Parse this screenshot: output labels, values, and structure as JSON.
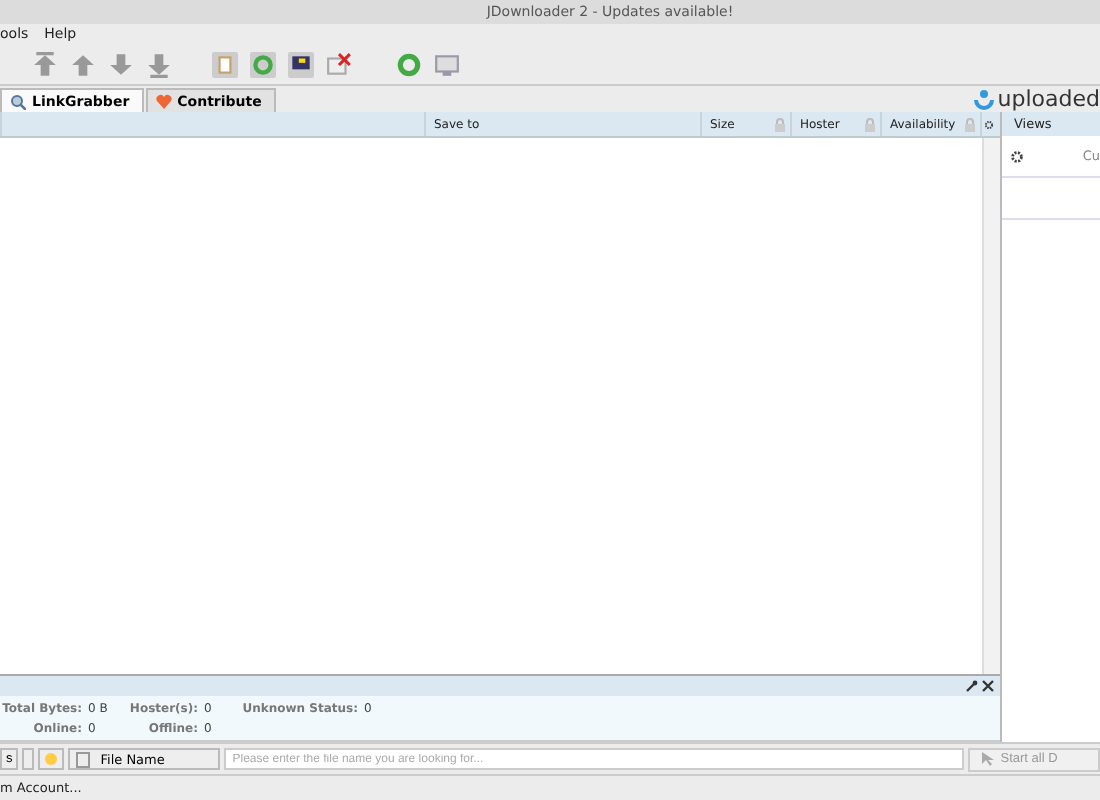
{
  "window": {
    "title": "JDownloader 2 - Updates available!"
  },
  "menu": [
    "ools",
    "Help"
  ],
  "tabs": [
    {
      "label": "LinkGrabber",
      "selected": true
    },
    {
      "label": "Contribute",
      "selected": false
    }
  ],
  "brand": {
    "text": "uploaded"
  },
  "table": {
    "columns": [
      {
        "locked": false
      },
      {
        "label": "Save to",
        "locked": false
      },
      {
        "label": "Size",
        "locked": true
      },
      {
        "label": "Hoster",
        "locked": true
      },
      {
        "label": "Availability",
        "locked": true
      }
    ]
  },
  "side_panel": {
    "title": "Views",
    "item": "Cu"
  },
  "stats": [
    [
      {
        "label": "Total Bytes:",
        "value": "0 B"
      },
      {
        "label": "Hoster(s):",
        "value": "0"
      },
      {
        "label": "Unknown Status:",
        "value": "0"
      }
    ],
    [
      {
        "label": "Online:",
        "value": "0"
      },
      {
        "label": "Offline:",
        "value": "0"
      }
    ]
  ],
  "search": {
    "left_label": "s",
    "column": "File Name",
    "placeholder": "Please enter the file name you are looking for..."
  },
  "start_button": "Start all D",
  "status_bar": "m Account..."
}
